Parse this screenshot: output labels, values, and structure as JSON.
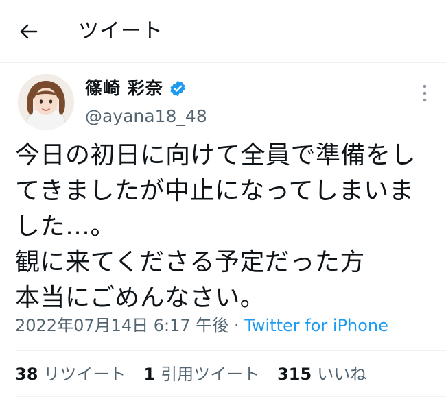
{
  "header": {
    "back_icon": "arrow-left-icon",
    "title": "ツイート"
  },
  "author": {
    "name": "篠崎 彩奈",
    "handle": "@ayana18_48",
    "verified_icon": "verified-badge-icon",
    "verified_color": "#1d9bf0",
    "more_icon": "more-vertical-icon"
  },
  "tweet": {
    "lines": [
      "今日の初日に向けて全員で準備をし",
      "てきましたが中止になってしまいま",
      "した…。",
      "観に来てくださる予定だった方",
      "本当にごめんなさい。"
    ]
  },
  "meta": {
    "timestamp": "2022年07月14日 6:17 午後",
    "separator": " · ",
    "source": "Twitter for iPhone",
    "source_color": "#1d9bf0"
  },
  "stats": {
    "retweets_count": "38",
    "retweets_label": "リツイート",
    "quotes_count": "1",
    "quotes_label": "引用ツイート",
    "likes_count": "315",
    "likes_label": "いいね"
  }
}
